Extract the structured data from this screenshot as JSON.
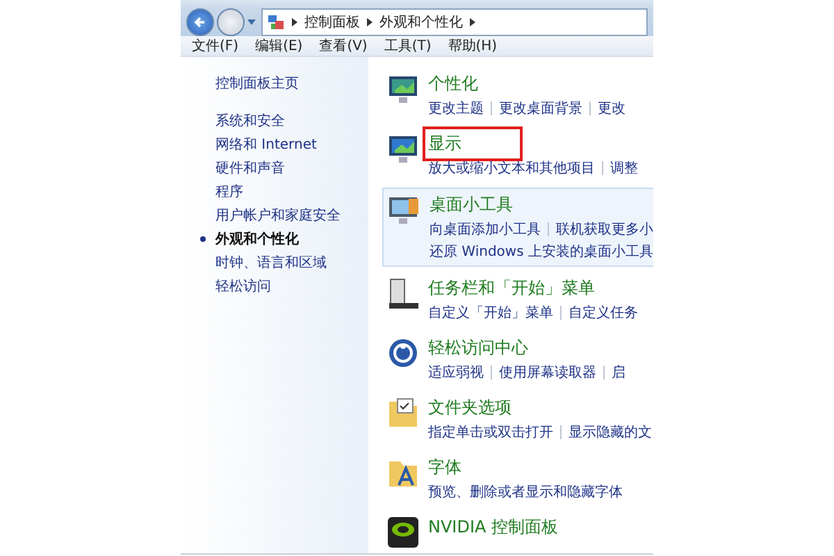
{
  "address_bar": {
    "crumbs": [
      "控制面板",
      "外观和个性化"
    ]
  },
  "menu": [
    "文件(F)",
    "编辑(E)",
    "查看(V)",
    "工具(T)",
    "帮助(H)"
  ],
  "sidebar": {
    "home": "控制面板主页",
    "items": [
      {
        "label": "系统和安全",
        "selected": false
      },
      {
        "label": "网络和 Internet",
        "selected": false
      },
      {
        "label": "硬件和声音",
        "selected": false
      },
      {
        "label": "程序",
        "selected": false
      },
      {
        "label": "用户帐户和家庭安全",
        "selected": false
      },
      {
        "label": "外观和个性化",
        "selected": true
      },
      {
        "label": "时钟、语言和区域",
        "selected": false
      },
      {
        "label": "轻松访问",
        "selected": false
      }
    ]
  },
  "sections": [
    {
      "kind": "personalize",
      "title": "个性化",
      "highlighted": false,
      "marked": false,
      "link_rows": [
        [
          "更改主题",
          "更改桌面背景",
          "更改"
        ]
      ]
    },
    {
      "kind": "display",
      "title": "显示",
      "highlighted": false,
      "marked": true,
      "link_rows": [
        [
          "放大或缩小文本和其他项目",
          "调整"
        ]
      ]
    },
    {
      "kind": "gadgets",
      "title": "桌面小工具",
      "highlighted": true,
      "marked": false,
      "link_rows": [
        [
          "向桌面添加小工具",
          "联机获取更多小"
        ],
        [
          "还原 Windows 上安装的桌面小工具"
        ]
      ]
    },
    {
      "kind": "taskbar",
      "title": "任务栏和「开始」菜单",
      "highlighted": false,
      "marked": false,
      "link_rows": [
        [
          "自定义「开始」菜单",
          "自定义任务"
        ]
      ]
    },
    {
      "kind": "ease",
      "title": "轻松访问中心",
      "highlighted": false,
      "marked": false,
      "link_rows": [
        [
          "适应弱视",
          "使用屏幕读取器",
          "启"
        ]
      ]
    },
    {
      "kind": "folder",
      "title": "文件夹选项",
      "highlighted": false,
      "marked": false,
      "link_rows": [
        [
          "指定单击或双击打开",
          "显示隐藏的文"
        ]
      ]
    },
    {
      "kind": "fonts",
      "title": "字体",
      "highlighted": false,
      "marked": false,
      "link_rows": [
        [
          "预览、删除或者显示和隐藏字体"
        ]
      ]
    },
    {
      "kind": "nvidia",
      "title": "NVIDIA 控制面板",
      "highlighted": false,
      "marked": false
    }
  ]
}
